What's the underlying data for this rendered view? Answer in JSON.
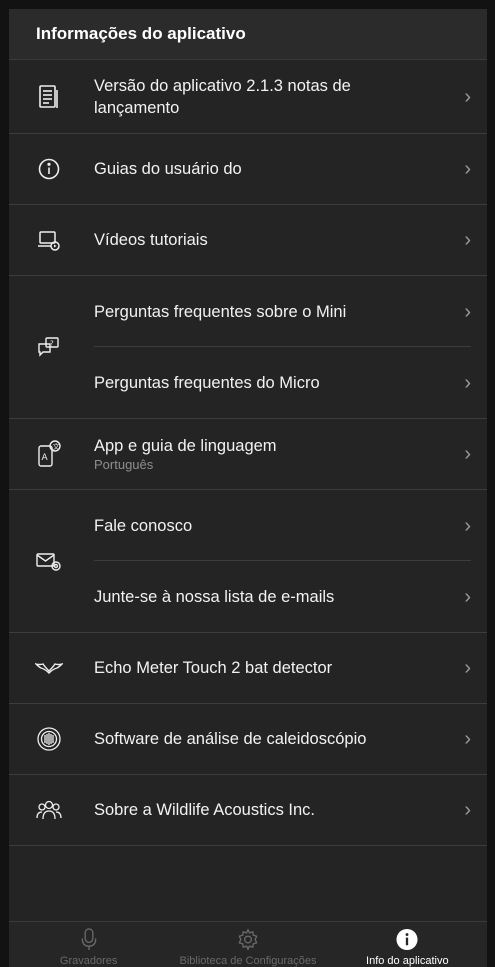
{
  "header": {
    "title": "Informações do aplicativo"
  },
  "rows": {
    "version": {
      "label": "Versão do aplicativo 2.1.3 notas de lançamento",
      "icon": "notes-icon"
    },
    "guides": {
      "label": "Guias do usuário do",
      "icon": "info-icon"
    },
    "videos": {
      "label": "Vídeos tutoriais",
      "icon": "video-icon"
    },
    "faq": {
      "icon": "faq-icon",
      "items": [
        "Perguntas frequentes sobre o Mini",
        "Perguntas frequentes do Micro"
      ]
    },
    "language": {
      "label": "App e guia de linguagem",
      "sublabel": "Português",
      "icon": "language-icon"
    },
    "contact": {
      "icon": "mail-icon",
      "items": [
        "Fale conosco",
        "Junte-se à nossa lista de e-mails"
      ]
    },
    "echo": {
      "label": "Echo Meter Touch 2 bat detector",
      "icon": "bat-icon"
    },
    "kaleidoscope": {
      "label": "Software de análise de caleidoscópio",
      "icon": "kaleidoscope-icon"
    },
    "about": {
      "label": "Sobre a Wildlife Acoustics Inc.",
      "icon": "people-icon"
    }
  },
  "chevron": "›",
  "tabs": [
    {
      "label": "Gravadores",
      "icon": "microphone-icon",
      "active": false
    },
    {
      "label": "Biblioteca de Configurações",
      "icon": "gear-icon",
      "active": false
    },
    {
      "label": "Info do aplicativo",
      "icon": "info-icon",
      "active": true
    }
  ]
}
